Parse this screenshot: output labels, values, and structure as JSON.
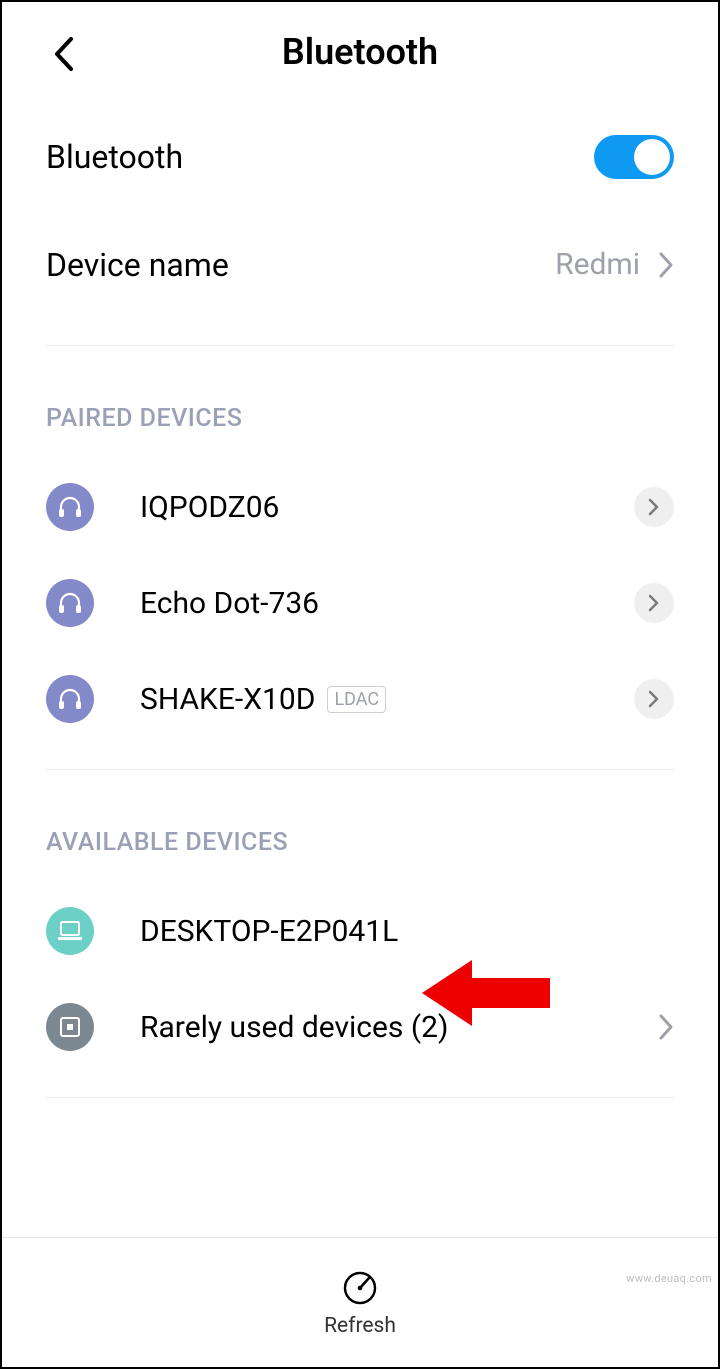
{
  "header": {
    "title": "Bluetooth"
  },
  "settings": {
    "bluetooth_label": "Bluetooth",
    "device_name_label": "Device name",
    "device_name_value": "Redmi"
  },
  "sections": {
    "paired_title": "PAIRED DEVICES",
    "available_title": "AVAILABLE DEVICES"
  },
  "paired": [
    {
      "name": "IQPODZ06",
      "codec": ""
    },
    {
      "name": "Echo Dot-736",
      "codec": ""
    },
    {
      "name": "SHAKE-X10D",
      "codec": "LDAC"
    }
  ],
  "available": [
    {
      "name": "DESKTOP-E2P041L"
    }
  ],
  "rarely": {
    "label": "Rarely used devices (2)"
  },
  "footer": {
    "refresh": "Refresh"
  },
  "watermark": "www.deuaq.com"
}
